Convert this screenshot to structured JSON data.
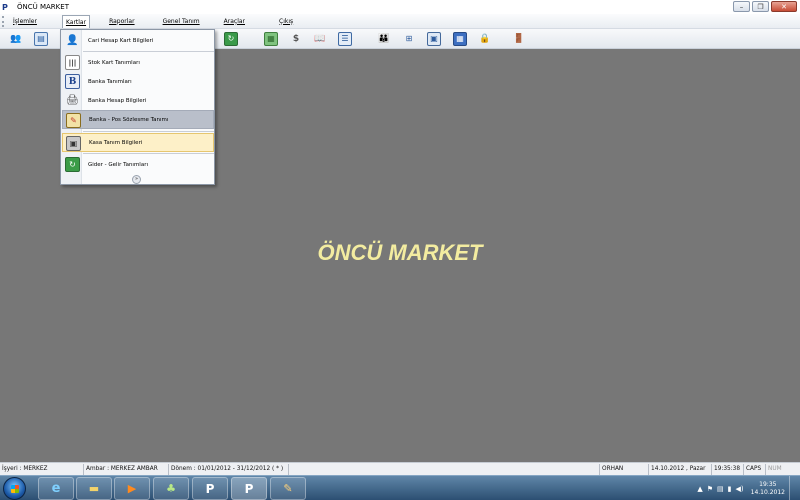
{
  "window": {
    "title": "ÖNCÜ MARKET",
    "app_icon_glyph": "P"
  },
  "menubar": {
    "items": [
      {
        "label": "İşlemler"
      },
      {
        "label": "Kartlar"
      },
      {
        "label": "Raporlar"
      },
      {
        "label": "Genel Tanım"
      },
      {
        "label": "Araçlar"
      },
      {
        "label": "Çıkış"
      }
    ]
  },
  "toolbar": {
    "icons": [
      "users-icon",
      "table-icon",
      "refresh-icon",
      "calculator-icon",
      "dollar-icon",
      "book-icon",
      "list-icon",
      "people-icon",
      "tree-icon",
      "window-icon",
      "calc-icon",
      "lock-icon",
      "exit-icon"
    ]
  },
  "dropdown": {
    "items": [
      {
        "label": "Cari Hesap Kart Bilgileri",
        "icon": "person-icon"
      },
      {
        "label": "Stok Kart Tanımları",
        "icon": "barcode-icon"
      },
      {
        "label": "Banka Tanımları",
        "icon": "bank-b-icon"
      },
      {
        "label": "Banka Hesap Bilgileri",
        "icon": "printer-icon"
      },
      {
        "label": "Banka - Pos Sözlesme Tanımı",
        "icon": "pos-icon"
      },
      {
        "label": "Kasa Tanım Bilgileri",
        "icon": "cashbox-icon"
      },
      {
        "label": "Gider - Gelir Tanımları",
        "icon": "recycle-icon"
      }
    ],
    "more_glyph": "»"
  },
  "main": {
    "center_title": "ÖNCÜ MARKET"
  },
  "statusbar": {
    "workplace": "İşyeri : MERKEZ",
    "warehouse": "Ambar : MERKEZ AMBAR",
    "period": "Dönem : 01/01/2012 - 31/12/2012 ( * )",
    "user": "ORHAN",
    "date": "14.10.2012 , Pazar",
    "time": "19:35:38",
    "caps": "CAPS",
    "num": "NUM"
  },
  "taskbar": {
    "clock_time": "19:35",
    "clock_date": "14.10.2012"
  },
  "colors": {
    "desktop_bg": "#777777",
    "center_title": "#f3eca0",
    "dropdown_hover_blue": "#b9bfca",
    "dropdown_hover_yellow": "#fdf0c8"
  }
}
